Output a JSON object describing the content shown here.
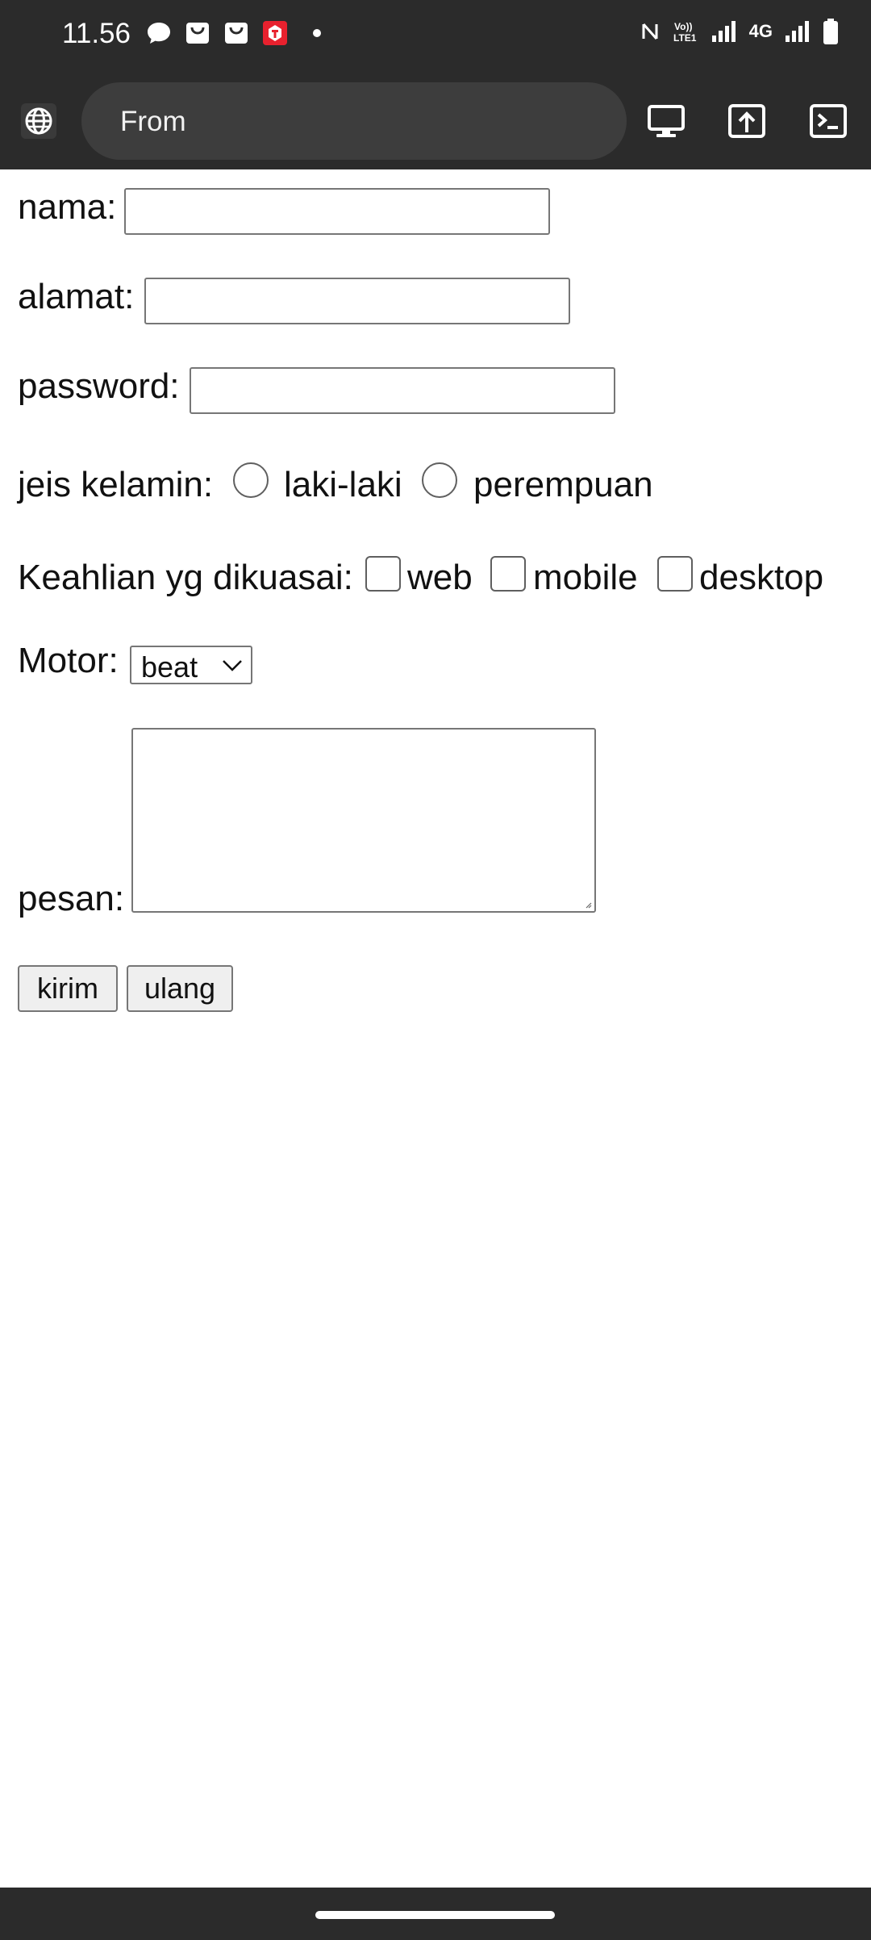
{
  "status_bar": {
    "time": "11.56",
    "network": "4G"
  },
  "browser": {
    "url_text": "From"
  },
  "form": {
    "nama_label": "nama:",
    "alamat_label": "alamat:",
    "password_label": "password:",
    "gender": {
      "label": "jeis kelamin:",
      "options": [
        "laki-laki",
        "perempuan"
      ]
    },
    "skills": {
      "label": "Keahlian yg dikuasai:",
      "options": [
        "web",
        "mobile",
        "desktop"
      ]
    },
    "motor": {
      "label": "Motor:",
      "selected": "beat"
    },
    "pesan_label": "pesan:",
    "submit_label": "kirim",
    "reset_label": "ulang"
  }
}
